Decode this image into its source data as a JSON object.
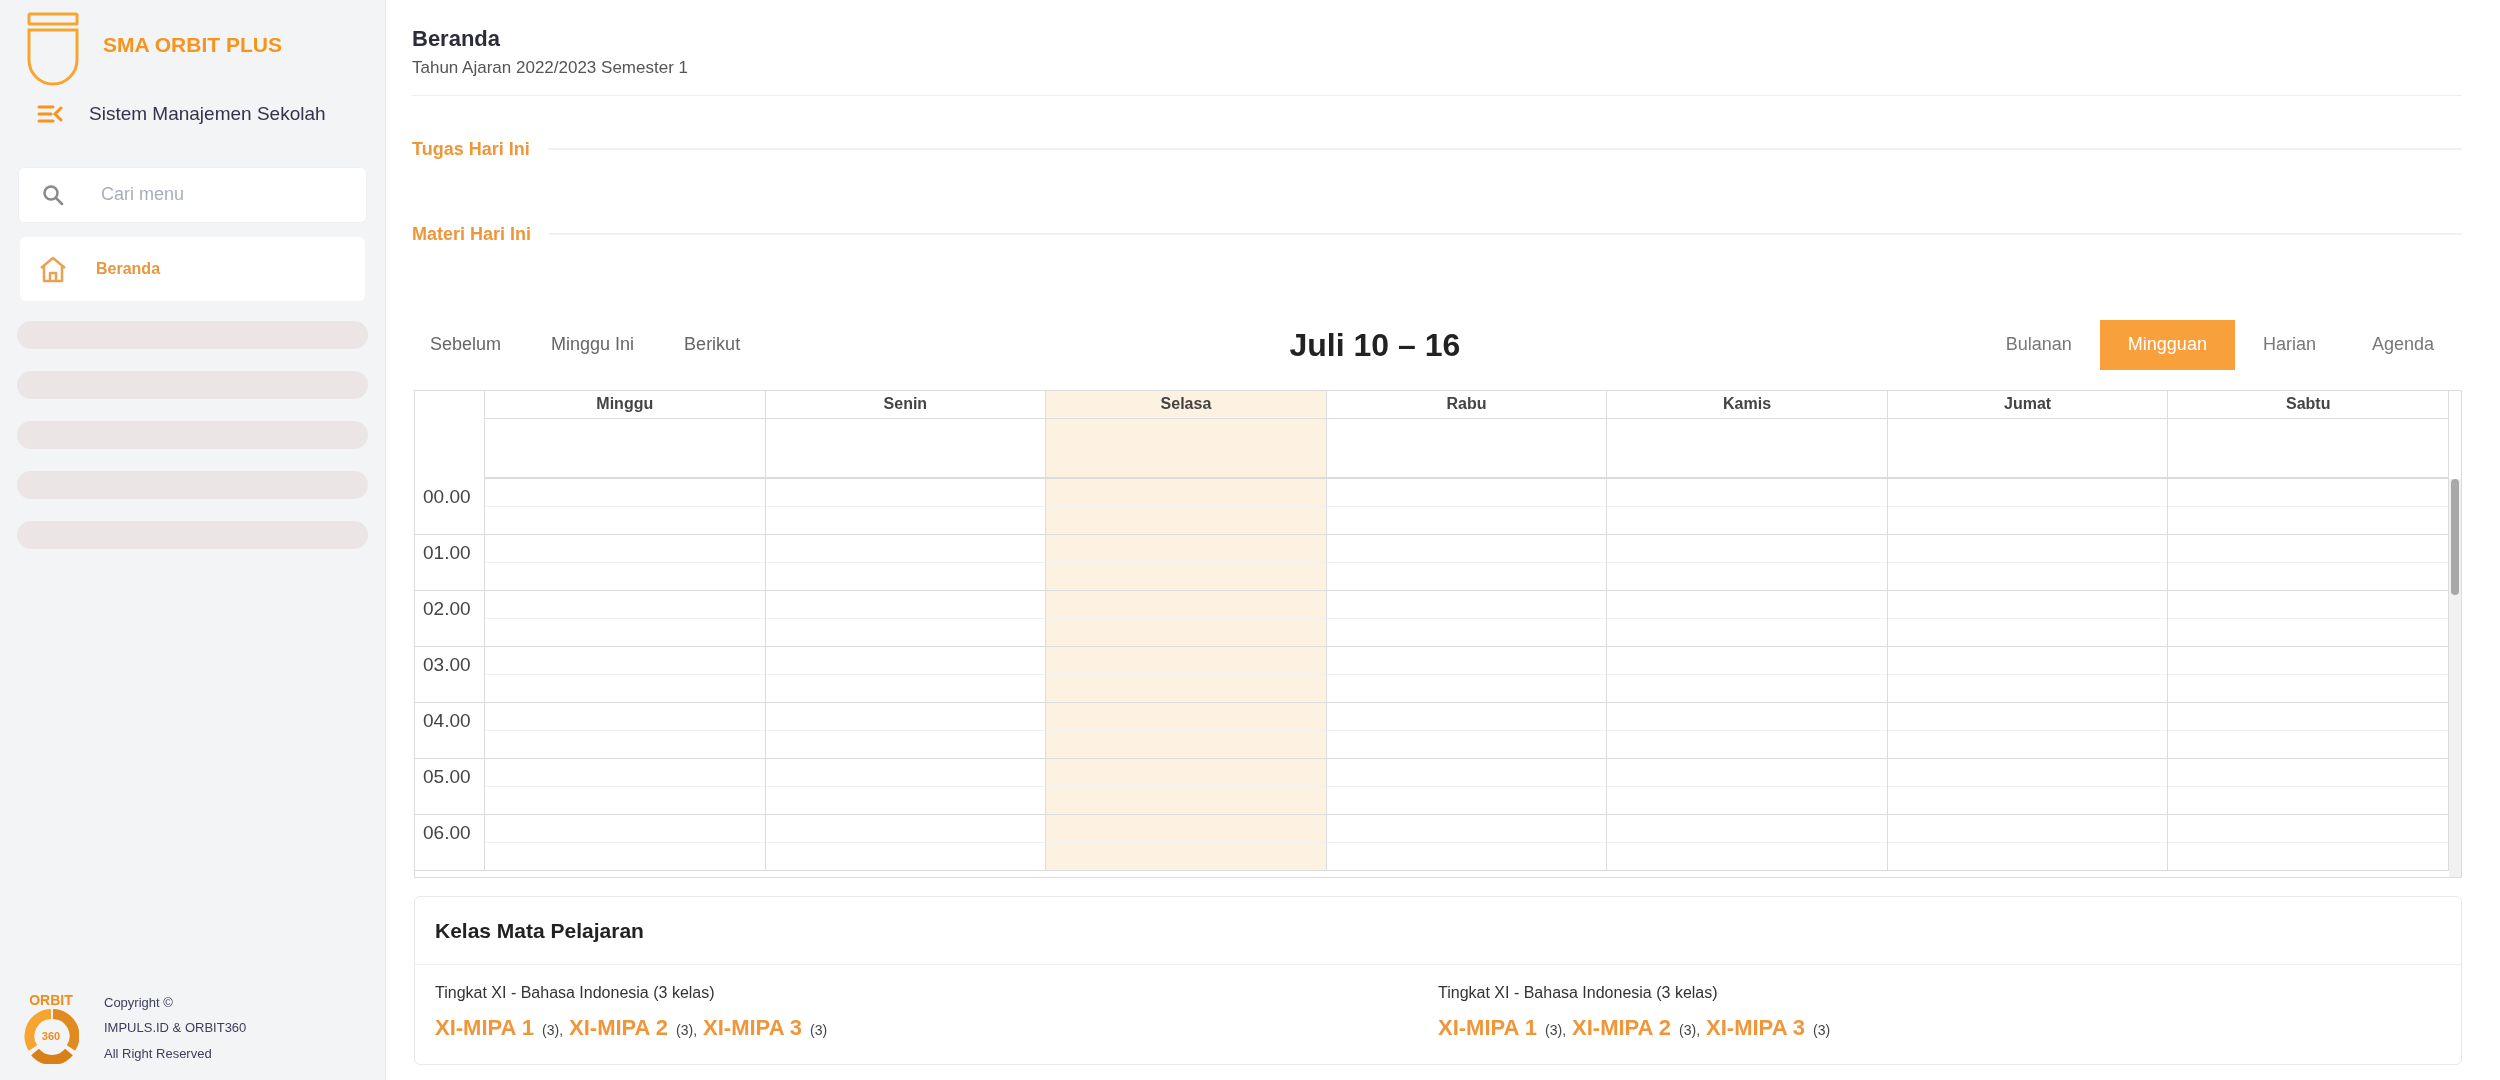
{
  "sidebar": {
    "school_name": "SMA ORBIT PLUS",
    "app_name": "Sistem Manajemen Sekolah",
    "search": {
      "placeholder": "Cari menu"
    },
    "menu": [
      {
        "kind": "item",
        "label": "Beranda",
        "selected": true
      },
      {
        "kind": "placeholder"
      },
      {
        "kind": "placeholder"
      },
      {
        "kind": "placeholder"
      },
      {
        "kind": "placeholder"
      },
      {
        "kind": "placeholder"
      }
    ],
    "footer_logo": {
      "top": "ORBIT",
      "center": "360"
    },
    "footer": [
      "Copyright ©",
      "IMPULS.ID & ORBIT360",
      "All Right Reserved"
    ]
  },
  "header": {
    "title": "Beranda",
    "subtitle": "Tahun Ajaran 2022/2023 Semester 1"
  },
  "sections": [
    {
      "title": "Tugas Hari Ini"
    },
    {
      "title": "Materi Hari Ini"
    }
  ],
  "calendar": {
    "nav": [
      "Sebelum",
      "Minggu Ini",
      "Berikut"
    ],
    "title": "Juli 10 – 16",
    "views": [
      {
        "label": "Bulanan",
        "selected": false
      },
      {
        "label": "Mingguan",
        "selected": true
      },
      {
        "label": "Harian",
        "selected": false
      },
      {
        "label": "Agenda",
        "selected": false
      }
    ],
    "days": [
      {
        "label": "Minggu",
        "today": false
      },
      {
        "label": "Senin",
        "today": false
      },
      {
        "label": "Selasa",
        "today": true
      },
      {
        "label": "Rabu",
        "today": false
      },
      {
        "label": "Kamis",
        "today": false
      },
      {
        "label": "Jumat",
        "today": false
      },
      {
        "label": "Sabtu",
        "today": false
      }
    ],
    "hours": [
      "00.00",
      "01.00",
      "02.00",
      "03.00",
      "04.00",
      "05.00",
      "06.00"
    ]
  },
  "classes": {
    "title": "Kelas Mata Pelajaran",
    "groups": [
      {
        "heading": "Tingkat XI - Bahasa Indonesia (3 kelas)",
        "separator": ",",
        "items": [
          {
            "name": "XI-MIPA 1",
            "count": "(3)"
          },
          {
            "name": "XI-MIPA 2",
            "count": "(3)"
          },
          {
            "name": "XI-MIPA 3",
            "count": "(3)"
          }
        ]
      },
      {
        "heading": "Tingkat XI - Bahasa Indonesia (3 kelas)",
        "separator": ",",
        "items": [
          {
            "name": "XI-MIPA 1",
            "count": "(3)"
          },
          {
            "name": "XI-MIPA 2",
            "count": "(3)"
          },
          {
            "name": "XI-MIPA 3",
            "count": "(3)"
          }
        ]
      }
    ]
  }
}
